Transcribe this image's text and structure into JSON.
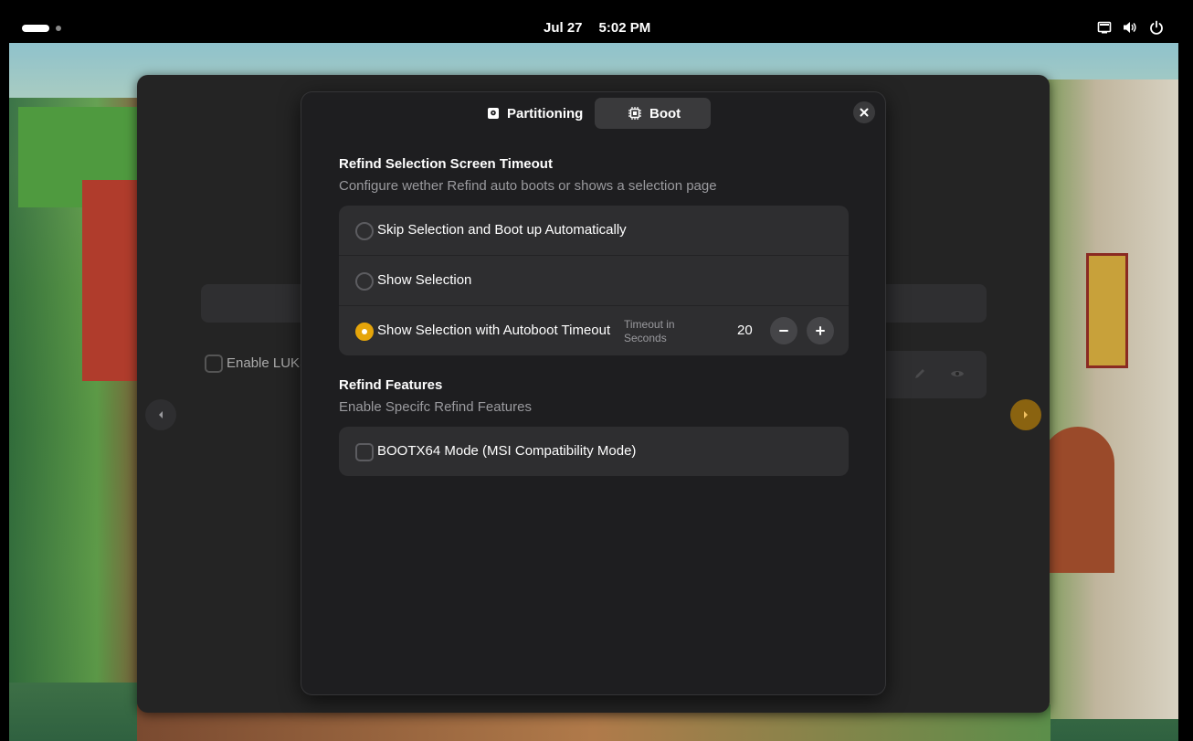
{
  "topbar": {
    "date": "Jul 27",
    "time": "5:02 PM",
    "icons": [
      "network-icon",
      "volume-icon",
      "power-icon"
    ]
  },
  "background_window": {
    "enable_luks_label": "Enable LUKS",
    "icons": [
      "edit-icon",
      "eye-icon"
    ]
  },
  "dialog": {
    "tabs": [
      {
        "label": "Partitioning",
        "icon": "drive-icon",
        "selected": false
      },
      {
        "label": "Boot",
        "icon": "chip-icon",
        "selected": true
      }
    ],
    "timeout_section": {
      "title": "Refind Selection Screen Timeout",
      "subtitle": "Configure wether Refind auto boots or shows a selection page",
      "options": [
        {
          "label": "Skip Selection and Boot up Automatically",
          "checked": false
        },
        {
          "label": "Show Selection",
          "checked": false
        },
        {
          "label": "Show Selection with Autoboot Timeout",
          "checked": true
        }
      ],
      "timeout_caption_line1": "Timeout in",
      "timeout_caption_line2": "Seconds",
      "timeout_value": "20"
    },
    "features_section": {
      "title": "Refind Features",
      "subtitle": "Enable Specifc Refind Features",
      "options": [
        {
          "label": "BOOTX64 Mode (MSI Compatibility Mode)",
          "checked": false
        }
      ]
    }
  },
  "colors": {
    "accent": "#e5a50a",
    "dialog_bg": "#1e1e20",
    "row_bg": "#2e2e30",
    "topbar_bg": "#000000"
  }
}
